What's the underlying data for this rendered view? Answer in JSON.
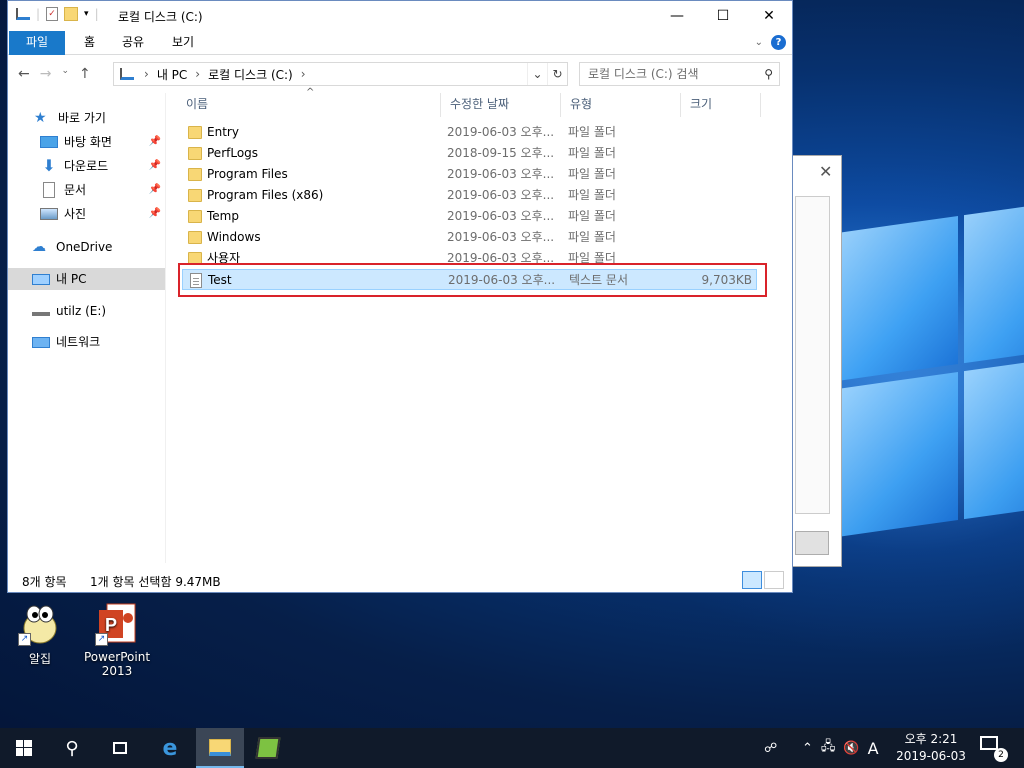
{
  "window": {
    "title": "로컬 디스크 (C:)",
    "controls": {
      "minimize": "—",
      "maximize": "☐",
      "close": "✕"
    }
  },
  "ribbon": {
    "tabs": [
      "파일",
      "홈",
      "공유",
      "보기"
    ],
    "help": "?"
  },
  "address": {
    "crumbs": [
      "내 PC",
      "로컬 디스크 (C:)"
    ],
    "search_placeholder": "로컬 디스크 (C:) 검색"
  },
  "nav": {
    "quick_access": "바로 가기",
    "pinned": [
      "바탕 화면",
      "다운로드",
      "문서",
      "사진"
    ],
    "onedrive": "OneDrive",
    "this_pc": "내 PC",
    "usb": "utilz (E:)",
    "network": "네트워크"
  },
  "columns": {
    "name": "이름",
    "date": "수정한 날짜",
    "type": "유형",
    "size": "크기"
  },
  "files": [
    {
      "name": "Entry",
      "date": "2019-06-03 오후...",
      "type": "파일 폴더",
      "size": "",
      "kind": "folder"
    },
    {
      "name": "PerfLogs",
      "date": "2018-09-15 오후...",
      "type": "파일 폴더",
      "size": "",
      "kind": "folder"
    },
    {
      "name": "Program Files",
      "date": "2019-06-03 오후...",
      "type": "파일 폴더",
      "size": "",
      "kind": "folder"
    },
    {
      "name": "Program Files (x86)",
      "date": "2019-06-03 오후...",
      "type": "파일 폴더",
      "size": "",
      "kind": "folder"
    },
    {
      "name": "Temp",
      "date": "2019-06-03 오후...",
      "type": "파일 폴더",
      "size": "",
      "kind": "folder"
    },
    {
      "name": "Windows",
      "date": "2019-06-03 오후...",
      "type": "파일 폴더",
      "size": "",
      "kind": "folder"
    },
    {
      "name": "사용자",
      "date": "2019-06-03 오후...",
      "type": "파일 폴더",
      "size": "",
      "kind": "folder"
    },
    {
      "name": "Test",
      "date": "2019-06-03 오후...",
      "type": "텍스트 문서",
      "size": "9,703KB",
      "kind": "text",
      "selected": true
    }
  ],
  "status": {
    "count": "8개 항목",
    "selection": "1개 항목 선택함 9.47MB"
  },
  "desktop_icons": [
    {
      "label": "알집"
    },
    {
      "label": "PowerPoint 2013"
    }
  ],
  "taskbar": {
    "clock_time": "오후 2:21",
    "clock_date": "2019-06-03",
    "ime": "A",
    "notifications": "2"
  }
}
